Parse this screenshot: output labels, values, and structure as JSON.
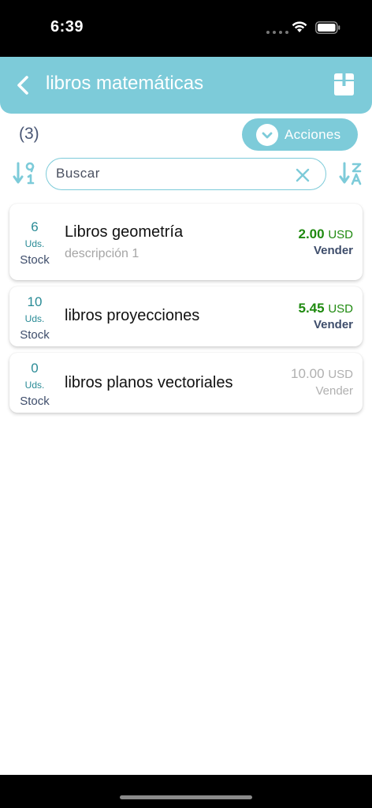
{
  "status_bar": {
    "time": "6:39"
  },
  "header": {
    "title": "libros matemáticas"
  },
  "toolbar": {
    "count": "(3)",
    "actions_label": "Acciones"
  },
  "search": {
    "placeholder": "Buscar",
    "value": ""
  },
  "products": [
    {
      "stock_qty": "6",
      "stock_unit": "Uds.",
      "stock_label": "Stock",
      "name": "Libros geometría",
      "description": "descripción 1",
      "price": "2.00",
      "currency": "USD",
      "action": "Vender"
    },
    {
      "stock_qty": "10",
      "stock_unit": "Uds.",
      "stock_label": "Stock",
      "name": "libros proyecciones",
      "description": "",
      "price": "5.45",
      "currency": "USD",
      "action": "Vender"
    },
    {
      "stock_qty": "0",
      "stock_unit": "Uds.",
      "stock_label": "Stock",
      "name": "libros planos vectoriales",
      "description": "",
      "price": "10.00",
      "currency": "USD",
      "action": "Vender"
    }
  ],
  "colors": {
    "accent": "#7dcbd9",
    "price_green": "#1f8a10",
    "teal_text": "#2a8b96"
  },
  "icons": [
    "back-arrow-icon",
    "box-icon",
    "chevron-down-icon",
    "sort-numeric-icon",
    "clear-icon",
    "sort-alpha-icon"
  ]
}
